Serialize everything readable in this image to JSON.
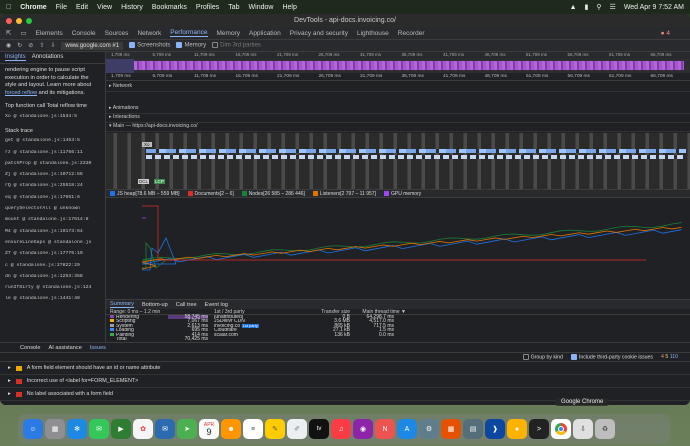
{
  "menubar": {
    "app": "Chrome",
    "items": [
      "File",
      "Edit",
      "View",
      "History",
      "Bookmarks",
      "Profiles",
      "Tab",
      "Window",
      "Help"
    ],
    "datetime": "Wed Apr 9  7:52 AM"
  },
  "window": {
    "title": "DevTools - api-docs.invoicing.co/"
  },
  "devtools_tabs": [
    "Elements",
    "Console",
    "Sources",
    "Network",
    "Performance",
    "Memory",
    "Application",
    "Privacy and security",
    "Lighthouse",
    "Recorder"
  ],
  "active_tab": "Performance",
  "error_count": "4",
  "toolbar": {
    "url": "www.google.com #1",
    "screenshots": "Screenshots",
    "memory": "Memory",
    "disable": "Dim 3rd parties"
  },
  "left_panel": {
    "tabs": [
      "Insights",
      "Annotations"
    ],
    "text": "rendering engine to pause script execution in order to calculate the style and layout. Learn more about",
    "link": "forced reflow",
    "text2": "and its mitigations.",
    "heading": "Top function call Total reflow time",
    "first_call": "Xo @ standalone.js:1534:5",
    "stack_title": "Stack trace",
    "stack": [
      "get @ standalone.js:1453:5",
      "rz @ standalone.js:11766:11",
      "patchProp @ standalone.js:2330",
      "Zj @ standalone.js:10712:56",
      "rQ @ standalone.js:25518:24",
      "eq @ standalone.js:17651:6",
      "querySelectorAll @ unknown",
      "mount @ standalone.js:17614:8",
      "M4 @ standalone.js:19173:64",
      "ensureLineGaps @ standalone.js",
      "Z7 @ standalone.js:17776:19",
      "c @ standalone.js:27822:29",
      "dn @ standalone.js:1253:358",
      "runIfDirty @ standalone.js:124",
      "le @ standalone.js:1441:48"
    ]
  },
  "ruler_top": [
    "1,709 ms",
    "6,709 ms",
    "11,709 ms",
    "16,709 ms",
    "21,709 ms",
    "26,709 ms",
    "31,709 ms",
    "36,709 ms",
    "41,709 ms",
    "46,709 ms",
    "51,709 ms",
    "56,709 ms",
    "61,709 ms",
    "66,709 ms"
  ],
  "tracks": {
    "network": "Network",
    "animations": "Animations",
    "interactions": "Interactions",
    "main": "Main — https://api-docs.invoicing.co/",
    "xo": "Xo",
    "dcl": "DCL",
    "lcp": "LCP"
  },
  "legend": [
    {
      "label": "JS heap[78.6 MB – 559 MB]",
      "color": "#1a73e8"
    },
    {
      "label": "Documents[2 – 6]",
      "color": "#d93025"
    },
    {
      "label": "Nodes[26 585 – 286 446]",
      "color": "#188038"
    },
    {
      "label": "Listeners[2 797 – 11 957]",
      "color": "#e37400"
    },
    {
      "label": "GPU memory",
      "color": "#a142f4"
    }
  ],
  "bottom_tabs": [
    "Summary",
    "Bottom-up",
    "Call tree",
    "Event log"
  ],
  "summary": {
    "range": "Range: 0 ms – 1.2 min",
    "col_party": "1st / 3rd party",
    "col_transfer": "Transfer size",
    "col_main": "Main thread time ▼",
    "categories": [
      {
        "name": "Rendering",
        "value": "58,745 ms",
        "color": "#8e44ad"
      },
      {
        "name": "Scripting",
        "value": "7,067 ms",
        "color": "#f4b400"
      },
      {
        "name": "System",
        "value": "2,613 ms",
        "color": "#9e9e9e"
      },
      {
        "name": "Loading",
        "value": "695 ms",
        "color": "#4285f4"
      },
      {
        "name": "Painting",
        "value": "414 ms",
        "color": "#34a853"
      },
      {
        "name": "Total",
        "value": "70,425 ms",
        "color": "#202124"
      }
    ],
    "parties": [
      {
        "name": "[unattributed]",
        "transfer": "0 B",
        "time": "64,298.7 ms",
        "badge": ""
      },
      {
        "name": "JSDelivr CDN",
        "transfer": "3.6 MB",
        "time": "4,517.0 ms",
        "badge": ""
      },
      {
        "name": "invoicing.co",
        "transfer": "865 kB",
        "time": "717.5 ms",
        "badge": "1st party"
      },
      {
        "name": "Cloudflare",
        "transfer": "27.1 kB",
        "time": "1.5 ms",
        "badge": ""
      },
      {
        "name": "scalar.com",
        "transfer": "136 kB",
        "time": "0.0 ms",
        "badge": ""
      }
    ]
  },
  "drawer": {
    "tabs": [
      "Console",
      "AI assistance",
      "Issues"
    ],
    "group_by_kind": "Group by kind",
    "third_party": "Include third-party cookie issues",
    "counts": [
      "4",
      "5",
      "110"
    ],
    "issues": [
      {
        "text": "A form field element should have an id or name attribute",
        "color": "#f2a600"
      },
      {
        "text": "Incorrect use of <label for=FORM_ELEMENT>",
        "color": "#d93025"
      },
      {
        "text": "No label associated with a form field",
        "color": "#d93025"
      }
    ]
  },
  "dock": {
    "hover_label": "Google Chrome",
    "calendar_month": "APR",
    "calendar_day": "9",
    "tv_label": "tv"
  }
}
